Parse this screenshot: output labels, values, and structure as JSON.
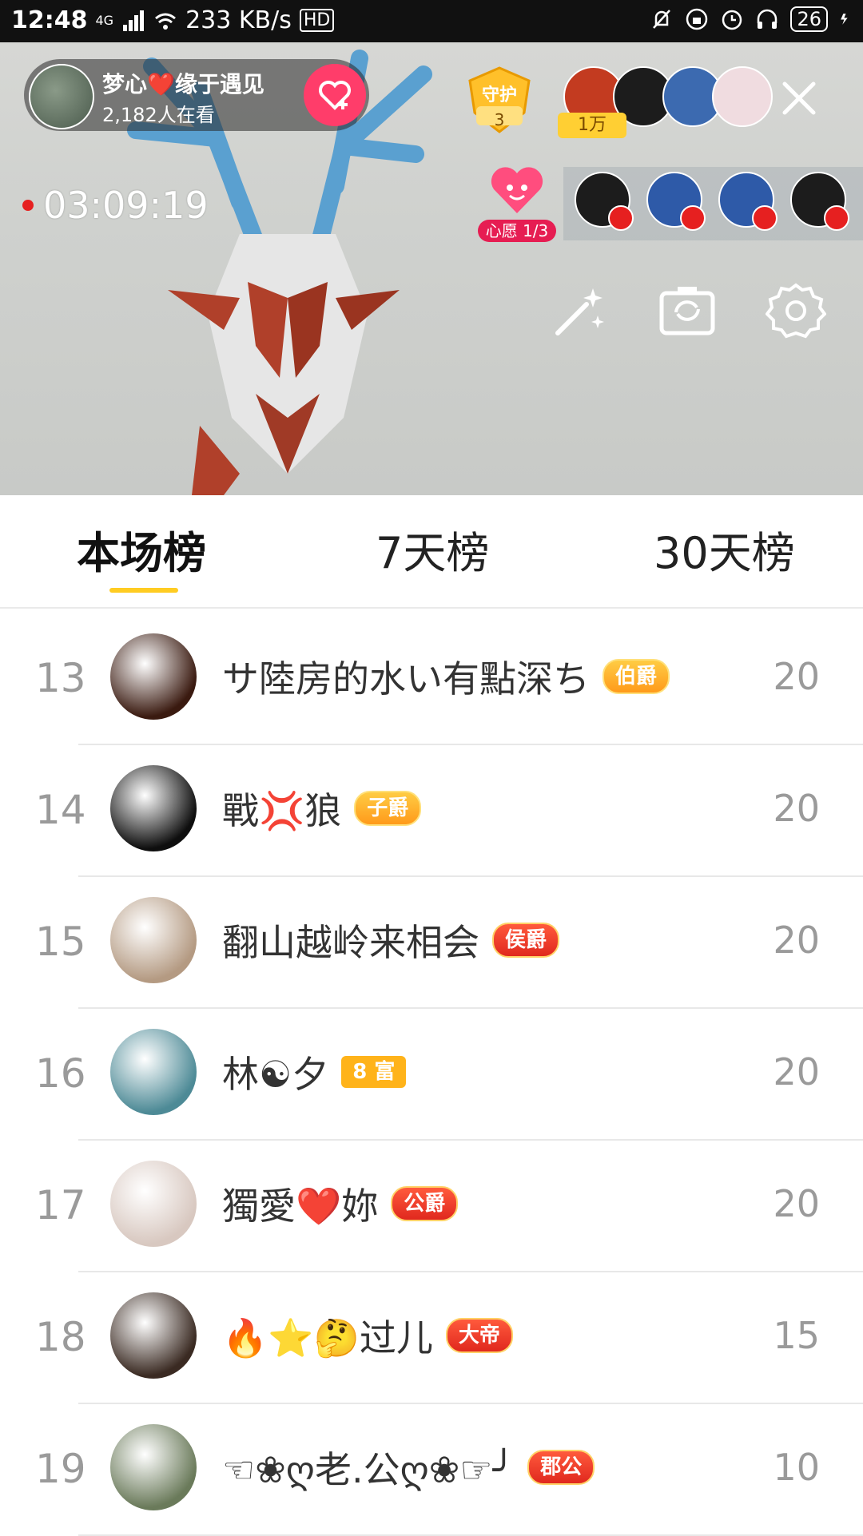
{
  "status_bar": {
    "time": "12:48",
    "network": "4G",
    "speed": "233 KB/s",
    "hd": "HD",
    "battery": "26"
  },
  "live": {
    "host_name": "梦心❤️缘于遇见",
    "viewers": "2,182人在看",
    "guard_label": "守护",
    "guard_count": "3",
    "rank_pill": "1万",
    "timer": "03:09:19",
    "wish_label": "心愿 1/3"
  },
  "tabs": [
    {
      "label": "本场榜",
      "active": true
    },
    {
      "label": "7天榜",
      "active": false
    },
    {
      "label": "30天榜",
      "active": false
    }
  ],
  "leaderboard": [
    {
      "rank": "13",
      "name": "サ陸房的水い有點深ち",
      "badge": "伯爵",
      "badge_style": "gold",
      "score": "20",
      "avatar_color": "#3a1a10"
    },
    {
      "rank": "14",
      "name": "戰💢狼",
      "badge": "子爵",
      "badge_style": "gold",
      "score": "20",
      "avatar_color": "#0e0e0e"
    },
    {
      "rank": "15",
      "name": "翻山越岭来相会",
      "badge": "侯爵",
      "badge_style": "red",
      "score": "20",
      "avatar_color": "#b49a82"
    },
    {
      "rank": "16",
      "name": "林☯夕",
      "badge": "8 富",
      "badge_style": "rich",
      "score": "20",
      "avatar_color": "#4d8a96"
    },
    {
      "rank": "17",
      "name": "獨愛❤️妳",
      "badge": "公爵",
      "badge_style": "red",
      "score": "20",
      "avatar_color": "#d8c8c0"
    },
    {
      "rank": "18",
      "name": "🔥⭐🤔过儿",
      "badge": "大帝",
      "badge_style": "red",
      "score": "15",
      "avatar_color": "#3a2a22"
    },
    {
      "rank": "19",
      "name": "☜❀ღ老.公ღ❀☞╯",
      "badge": "郡公",
      "badge_style": "red",
      "score": "10",
      "avatar_color": "#6a7a5a"
    }
  ]
}
